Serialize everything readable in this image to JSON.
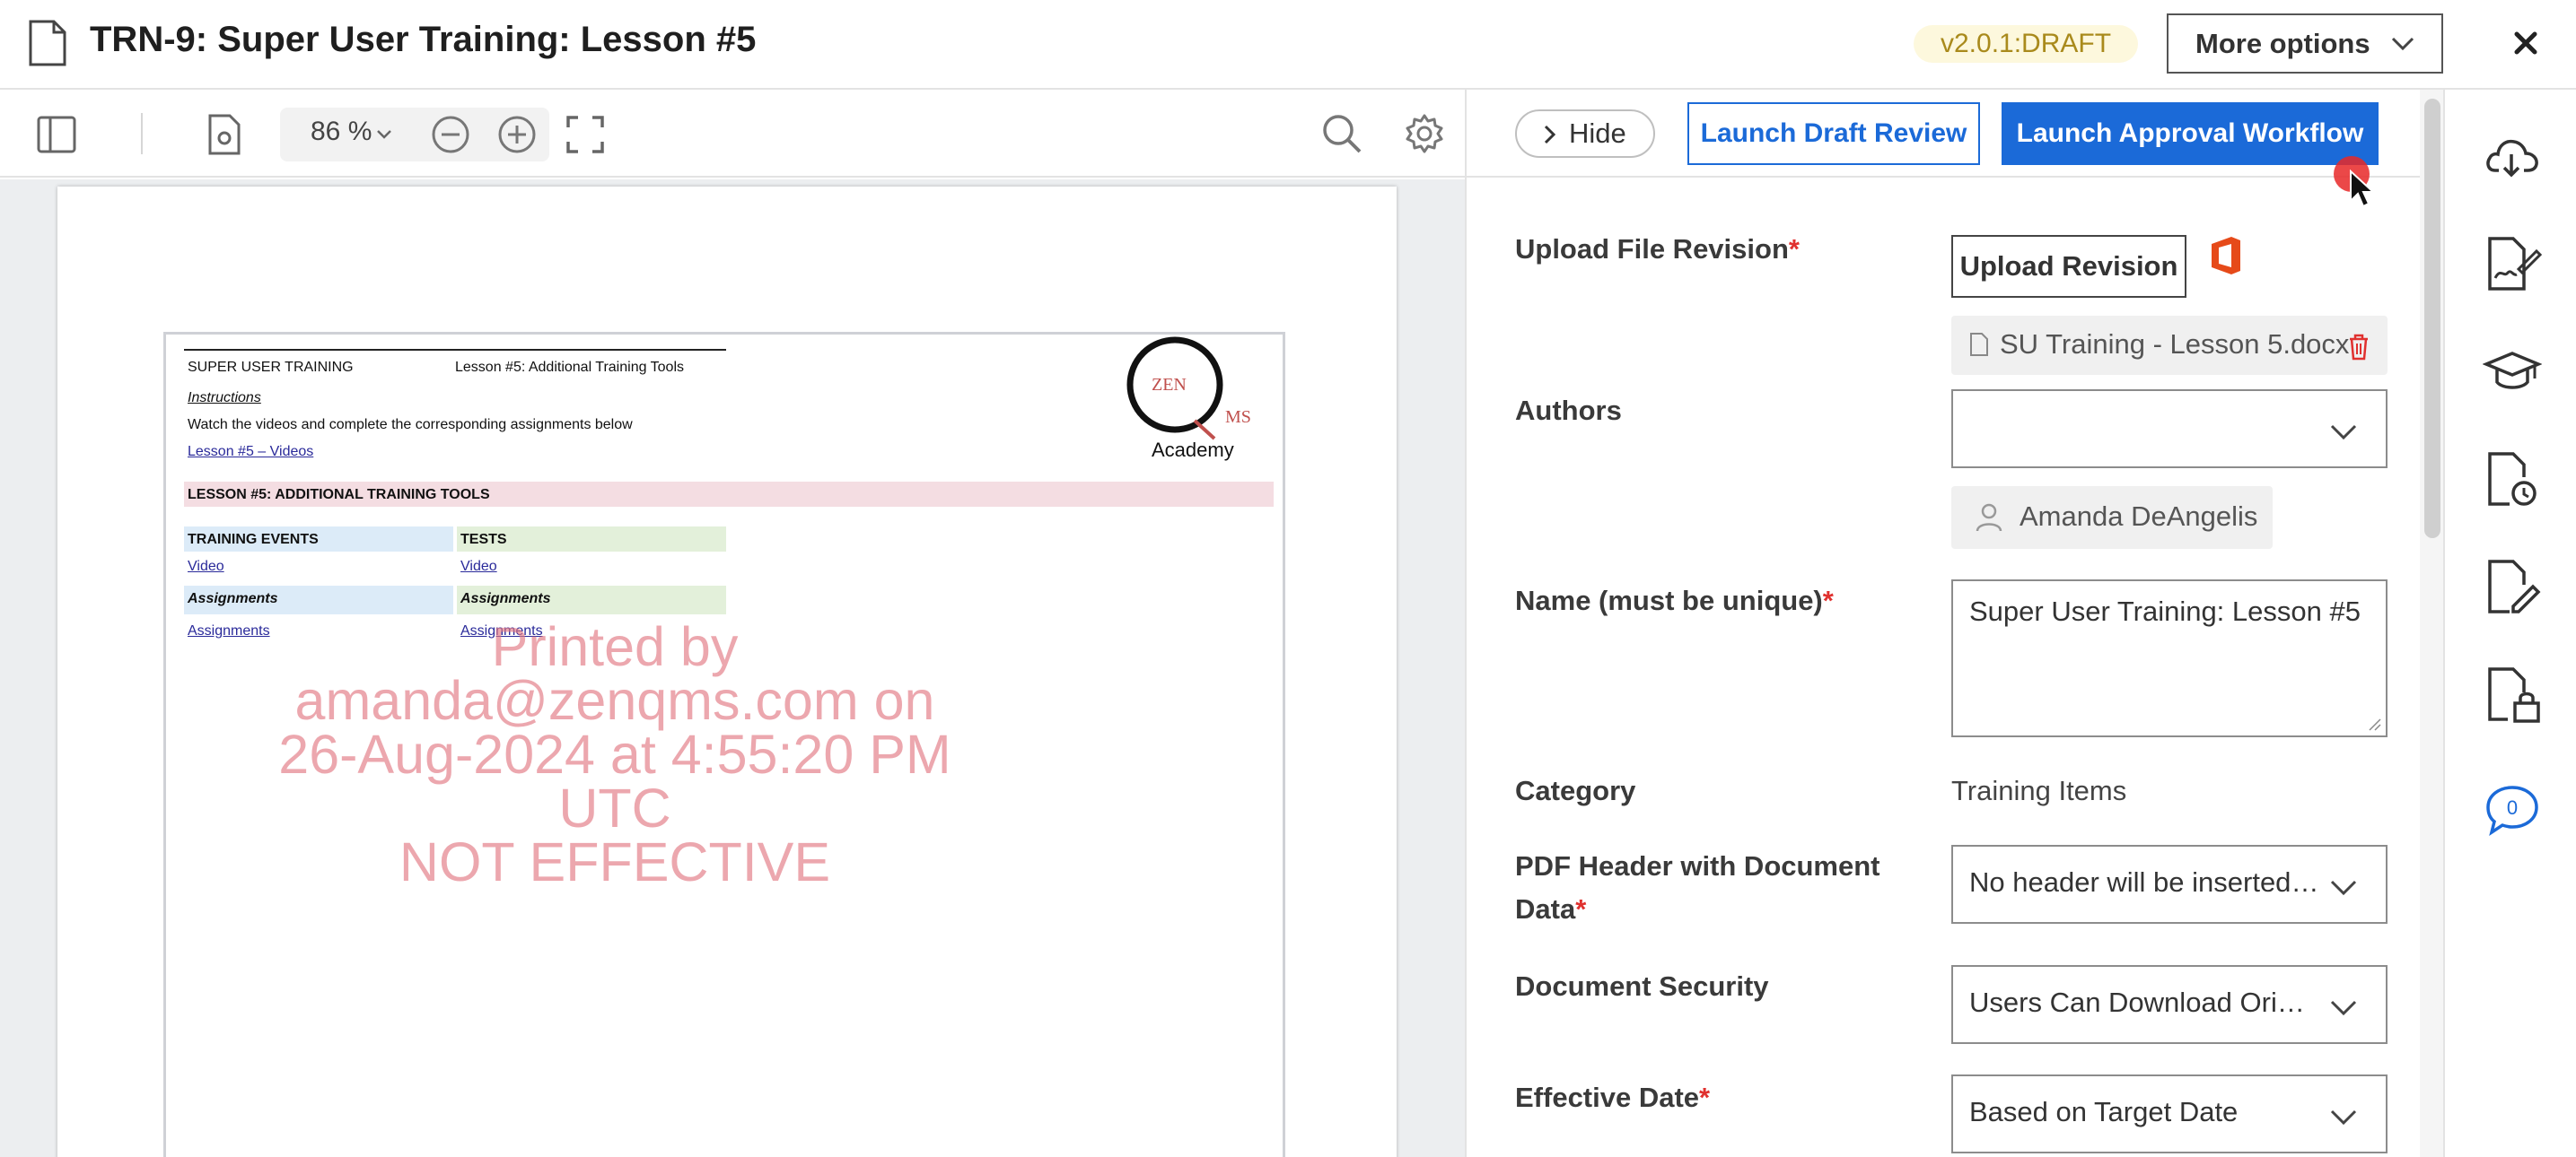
{
  "header": {
    "title": "TRN-9: Super User Training: Lesson #5",
    "version": "v2.0.1:DRAFT",
    "more_options": "More options"
  },
  "viewer_toolbar": {
    "zoom": "86 %"
  },
  "document_preview": {
    "header_left": "SUPER USER TRAINING",
    "header_right": "Lesson #5: Additional Training Tools",
    "instructions_heading": "Instructions",
    "instructions_text": "Watch the videos and complete the corresponding assignments below",
    "videos_link": "Lesson #5 – Videos",
    "lesson_title": "LESSON #5: ADDITIONAL TRAINING TOOLS",
    "col_training_events": "TRAINING EVENTS",
    "col_tests": "TESTS",
    "video_link_1": "Video",
    "video_link_2": "Video",
    "assignments_heading_1": "Assignments",
    "assignments_heading_2": "Assignments",
    "assignments_link_1": "Assignments",
    "assignments_link_2": "Assignments",
    "logo_zen": "ZEN",
    "logo_qms": "MS",
    "logo_academy": "Academy",
    "watermark_line1": "Printed by amanda@zenqms.com on",
    "watermark_line2": "26-Aug-2024 at 4:55:20 PM UTC",
    "watermark_line3": "NOT EFFECTIVE"
  },
  "panel": {
    "hide_label": "Hide",
    "draft_review_label": "Launch Draft Review",
    "approval_workflow_label": "Launch Approval Workflow",
    "fields": {
      "upload_label": "Upload File Revision",
      "upload_button": "Upload Revision",
      "file_name": "SU Training - Lesson 5.docx",
      "authors_label": "Authors",
      "author_name": "Amanda DeAngelis",
      "name_label": "Name (must be unique)",
      "name_value": "Super User Training: Lesson #5",
      "category_label": "Category",
      "category_value": "Training Items",
      "pdf_header_label_1": "PDF Header with Document",
      "pdf_header_label_2": "Data",
      "pdf_header_value": "No header will be inserted i...",
      "security_label": "Document Security",
      "security_value": "Users Can Download Origi...",
      "effective_label": "Effective Date",
      "effective_value": "Based on Target Date",
      "required_mark": "*"
    }
  },
  "rail": {
    "comments_count": "0"
  },
  "colors": {
    "accent": "#1b6ad8",
    "required": "#e0312f",
    "version_bg": "#fdf8dd",
    "version_text": "#a98a1c",
    "watermark": "#e27882"
  }
}
